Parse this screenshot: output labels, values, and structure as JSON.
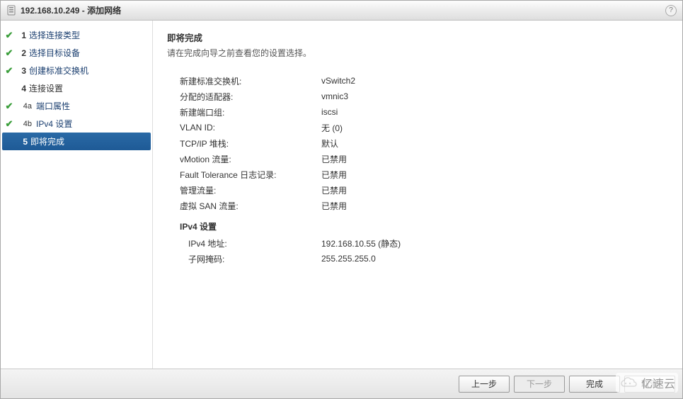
{
  "title": {
    "host_ip": "192.168.10.249",
    "separator": " - ",
    "action": "添加网络"
  },
  "help_tooltip": "?",
  "sidebar": {
    "steps": [
      {
        "num": "1",
        "label": "选择连接类型",
        "checked": true,
        "sub": false,
        "active": false,
        "pending": false
      },
      {
        "num": "2",
        "label": "选择目标设备",
        "checked": true,
        "sub": false,
        "active": false,
        "pending": false
      },
      {
        "num": "3",
        "label": "创建标准交换机",
        "checked": true,
        "sub": false,
        "active": false,
        "pending": false
      },
      {
        "num": "4",
        "label": "连接设置",
        "checked": false,
        "sub": false,
        "active": false,
        "pending": true
      },
      {
        "num": "4a",
        "label": "端口属性",
        "checked": true,
        "sub": true,
        "active": false,
        "pending": false
      },
      {
        "num": "4b",
        "label": "IPv4 设置",
        "checked": true,
        "sub": true,
        "active": false,
        "pending": false
      },
      {
        "num": "5",
        "label": "即将完成",
        "checked": false,
        "sub": false,
        "active": true,
        "pending": false
      }
    ]
  },
  "content": {
    "heading": "即将完成",
    "subheading": "请在完成向导之前查看您的设置选择。",
    "rows": [
      {
        "label": "新建标准交换机:",
        "value": "vSwitch2"
      },
      {
        "label": "分配的适配器:",
        "value": "vmnic3"
      },
      {
        "label": "新建端口组:",
        "value": "iscsi"
      },
      {
        "label": "VLAN ID:",
        "value": "无 (0)"
      },
      {
        "label": "TCP/IP 堆栈:",
        "value": "默认"
      },
      {
        "label": "vMotion 流量:",
        "value": "已禁用"
      },
      {
        "label": "Fault Tolerance 日志记录:",
        "value": "已禁用"
      },
      {
        "label": "管理流量:",
        "value": "已禁用"
      },
      {
        "label": "虚拟 SAN 流量:",
        "value": "已禁用"
      }
    ],
    "ipv4_section": "IPv4 设置",
    "ipv4_rows": [
      {
        "label": "IPv4 地址:",
        "value": "192.168.10.55 (静态)"
      },
      {
        "label": "子网掩码:",
        "value": "255.255.255.0"
      }
    ]
  },
  "footer": {
    "back": "上一步",
    "next": "下一步",
    "finish": "完成",
    "cancel": "取消"
  },
  "watermark": "亿速云"
}
